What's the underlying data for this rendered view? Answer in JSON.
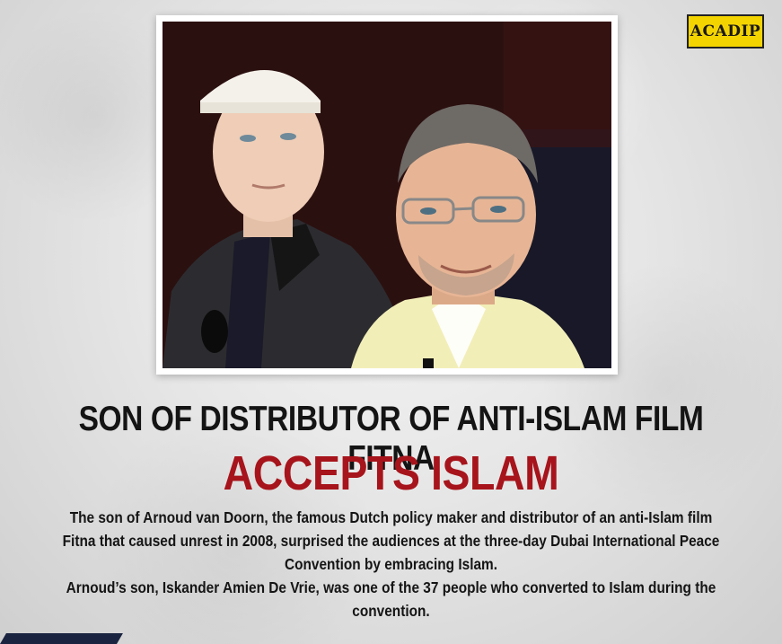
{
  "logo": {
    "text": "ACADIP"
  },
  "headline": "SON OF DISTRIBUTOR OF ANTI-ISLAM FILM FITNA",
  "subheadline": "ACCEPTS ISLAM",
  "body": {
    "paragraph1": "The son of Arnoud van Doorn, the famous Dutch policy maker and distributor of an anti-Islam film Fitna that caused unrest in 2008, surprised the audiences at the three-day Dubai International Peace Convention by embracing Islam.",
    "paragraph2": "Arnoud’s son, Iskander Amien De Vrie, was one of the 37 people who converted to Islam during the convention."
  },
  "colors": {
    "headline": "#141414",
    "subheadline": "#a7141b",
    "logo_bg": "#f3d400",
    "background": "#e6e6e6"
  }
}
